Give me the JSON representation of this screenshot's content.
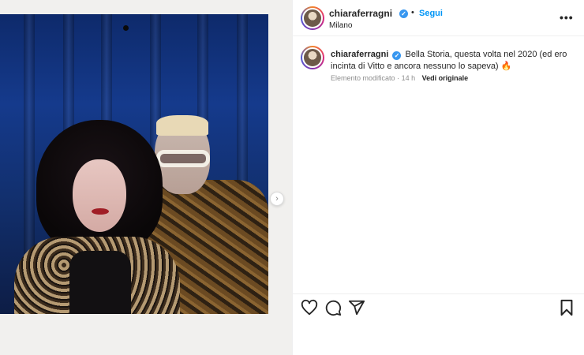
{
  "post": {
    "username": "chiaraferragni",
    "follow_label": "Segui",
    "location": "Milano",
    "separator": "•",
    "more_label": "•••"
  },
  "caption": {
    "username": "chiaraferragni",
    "text": "Bella Storia, questa volta nel 2020 (ed ero incinta di Vitto e ancora nessuno lo sapeva) 🔥",
    "edited_label": "Elemento modificato",
    "time_sep": "·",
    "time_ago": "14 h",
    "see_original": "Vedi originale"
  },
  "icons": {
    "like": "heart-icon",
    "comment": "comment-icon",
    "share": "paper-plane-icon",
    "save": "bookmark-icon",
    "verified": "verified-badge-icon",
    "next": "chevron-right-icon",
    "more": "more-options-icon"
  },
  "colors": {
    "link_blue": "#0095f6",
    "verified_blue": "#3897f0",
    "muted": "#8e8e8e",
    "text": "#262626"
  }
}
